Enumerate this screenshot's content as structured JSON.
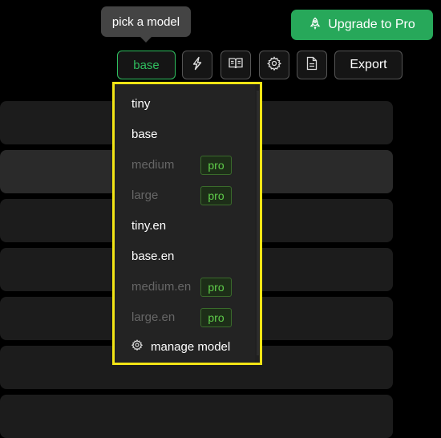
{
  "tooltip": {
    "text": "pick a model"
  },
  "header": {
    "upgrade_label": "Upgrade to Pro",
    "model_button_label": "base",
    "export_label": "Export",
    "icons": [
      "lightning-icon",
      "book-icon",
      "gear-icon",
      "document-icon"
    ]
  },
  "dropdown": {
    "items": [
      {
        "label": "tiny",
        "enabled": true,
        "badge": ""
      },
      {
        "label": "base",
        "enabled": true,
        "badge": ""
      },
      {
        "label": "medium",
        "enabled": false,
        "badge": "pro"
      },
      {
        "label": "large",
        "enabled": false,
        "badge": "pro"
      },
      {
        "label": "tiny.en",
        "enabled": true,
        "badge": ""
      },
      {
        "label": "base.en",
        "enabled": true,
        "badge": ""
      },
      {
        "label": "medium.en",
        "enabled": false,
        "badge": "pro"
      },
      {
        "label": "large.en",
        "enabled": false,
        "badge": "pro"
      }
    ],
    "manage_label": "manage model",
    "highlight_color": "#f2e415"
  },
  "colors": {
    "accent": "#27a85a",
    "active_outline": "#2fbf5f",
    "pro_badge": "#5fce4a"
  }
}
